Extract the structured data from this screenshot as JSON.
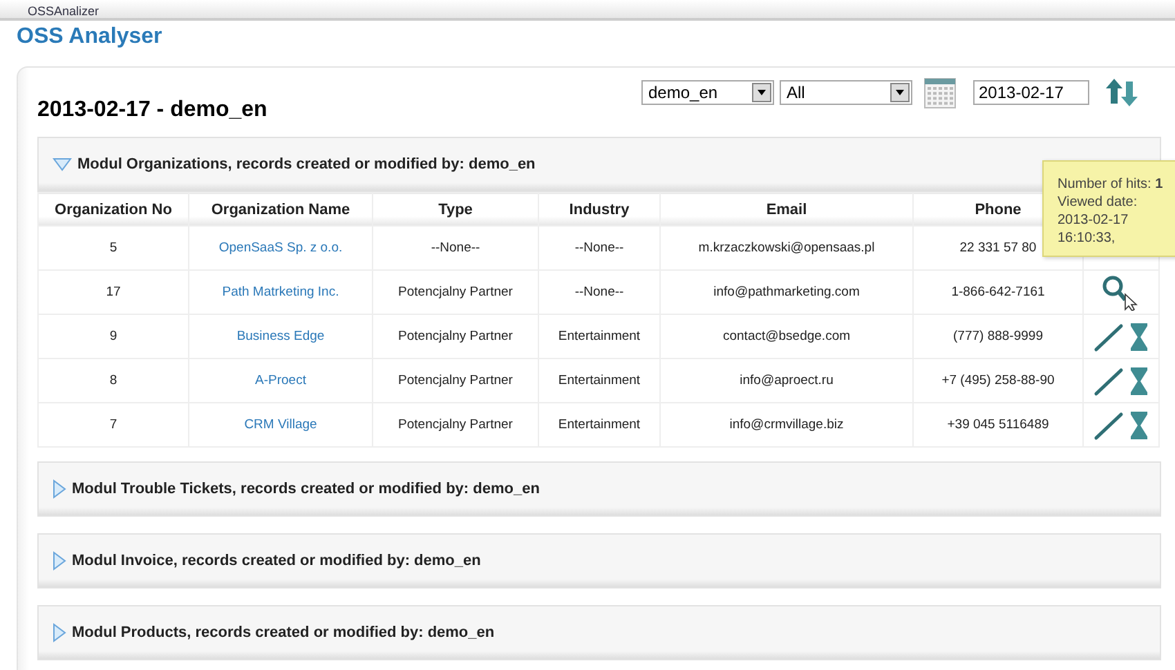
{
  "app_tab": "OSSAnalizer",
  "title": "OSS Analyser",
  "report_title": "2013-02-17 - demo_en",
  "filters": {
    "user": "demo_en",
    "module": "All",
    "date": "2013-02-17"
  },
  "sections": [
    {
      "label": "Modul Organizations, records created or modified by: demo_en",
      "expanded": true,
      "table": {
        "columns": [
          "Organization No",
          "Organization Name",
          "Type",
          "Industry",
          "Email",
          "Phone"
        ],
        "rows": [
          {
            "cells": [
              "5",
              "OpenSaaS Sp. z o.o.",
              "--None--",
              "--None--",
              "m.krzaczkowski@opensaas.pl",
              "22 331 57 80"
            ]
          },
          {
            "cells": [
              "17",
              "Path Matrketing Inc.",
              "Potencjalny Partner",
              "--None--",
              "info@pathmarketing.com",
              "1-866-642-7161"
            ],
            "actions": [
              {
                "kind": "search"
              }
            ]
          },
          {
            "cells": [
              "9",
              "Business Edge",
              "Potencjalny Partner",
              "Entertainment",
              "contact@bsedge.com",
              "(777) 888-9999"
            ],
            "actions": [
              {
                "kind": "edit"
              },
              {
                "kind": "history"
              }
            ]
          },
          {
            "cells": [
              "8",
              "A-Proect",
              "Potencjalny Partner",
              "Entertainment",
              "info@aproect.ru",
              "+7 (495) 258-88-90"
            ],
            "actions": [
              {
                "kind": "edit"
              },
              {
                "kind": "history"
              }
            ]
          },
          {
            "cells": [
              "7",
              "CRM Village",
              "Potencjalny Partner",
              "Entertainment",
              "info@crmvillage.biz",
              "+39 045 5116489"
            ],
            "actions": [
              {
                "kind": "edit"
              },
              {
                "kind": "history"
              }
            ]
          }
        ]
      }
    },
    {
      "label": "Modul Trouble Tickets, records created or modified by: demo_en",
      "expanded": false
    },
    {
      "label": "Modul Invoice, records created or modified by: demo_en",
      "expanded": false
    },
    {
      "label": "Modul Products, records created or modified by: demo_en",
      "expanded": false
    }
  ],
  "tooltip": {
    "lines": [
      "Number of hits: **1**",
      "Viewed date:",
      "2013-02-17",
      "16:10:33,"
    ]
  }
}
